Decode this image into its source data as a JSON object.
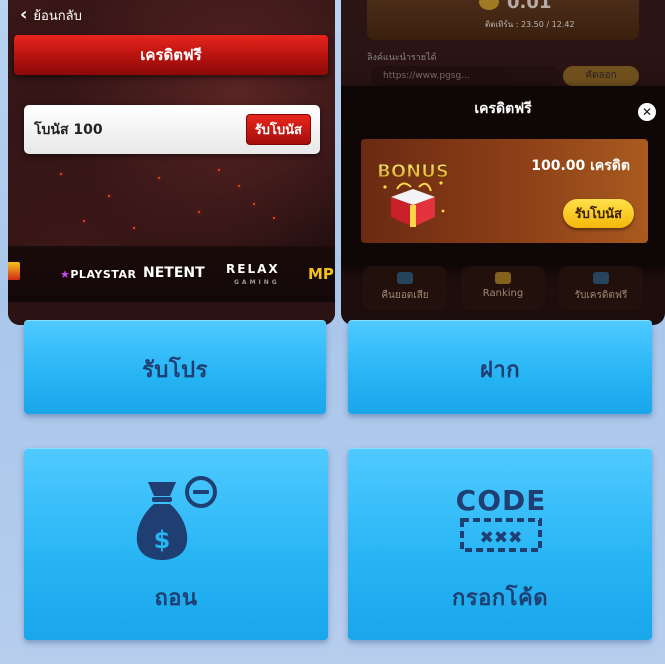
{
  "left_screen": {
    "back_label": "ย้อนกลับ",
    "title": "เครดิตฟรี",
    "bonus_item": {
      "name": "โบนัส 100",
      "button": "รับโบนัส"
    },
    "providers": [
      "PLAYSTAR",
      "NETENT",
      "RELAX",
      "GAMING",
      "MP"
    ]
  },
  "right_screen": {
    "balance_value": "0.01",
    "turnover": "ติดเทิร์น : 23.50 / 12.42",
    "link_label": "ลิงค์แนะนำรายได้",
    "link_value": "https://www.pgsg...",
    "copy_label": "คัดลอก",
    "modal": {
      "title": "เครดิตฟรี",
      "close_icon": "close-icon",
      "art_text": "BONUS",
      "amount": "100.00 เครดิต",
      "button": "รับโบนัส"
    },
    "tiles_behind": [
      "คืนยอดเสีย",
      "Ranking",
      "รับเครดิตฟรี"
    ]
  },
  "menu_tiles": {
    "promo": "รับโปร",
    "deposit": "ฝาก",
    "withdraw": "ถอน",
    "code": "กรอกโค้ด",
    "code_icon_text": "CODE",
    "code_icon_mask": "✖✖✖"
  },
  "colors": {
    "tile_blue": "#26b4f4",
    "tile_label": "#1f3f73",
    "red_accent": "#d41a12",
    "gold_button": "#f5b80b"
  }
}
